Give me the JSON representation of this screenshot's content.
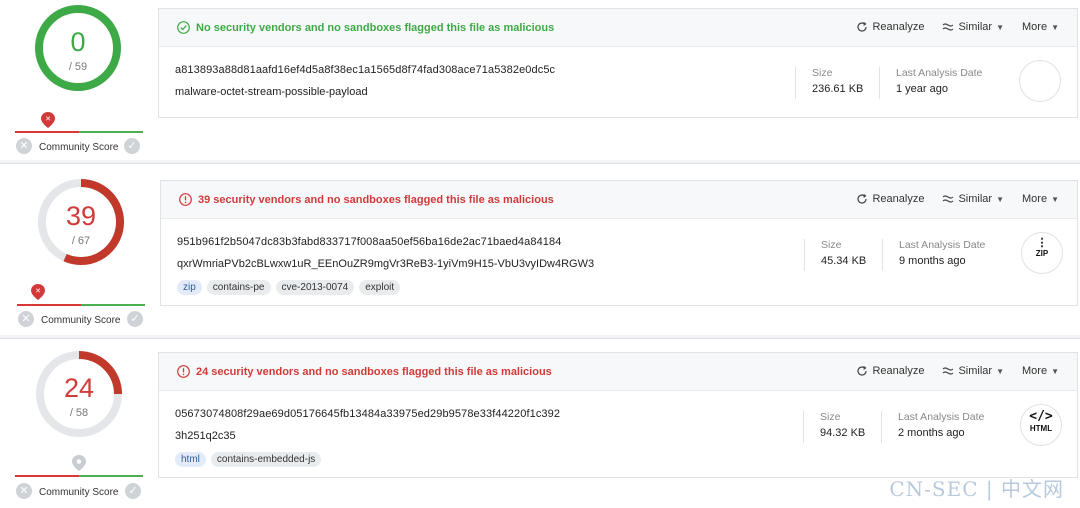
{
  "colors": {
    "clean": "#3eaa47",
    "malicious": "#d23a3a",
    "neutral": "#c9ccd0",
    "tag_blue": "#2f5e9e"
  },
  "actions": {
    "reanalyze": "Reanalyze",
    "similar": "Similar",
    "more": "More"
  },
  "meta_labels": {
    "size": "Size",
    "last_analysis": "Last Analysis Date"
  },
  "community_label": "Community Score",
  "results": [
    {
      "score": "0",
      "total": "/ 59",
      "detections": 0,
      "engines": 59,
      "verdict": "No security vendors and no sandboxes flagged this file as malicious",
      "verdict_status": "clean",
      "hash": "a813893a88d81aafd16ef4d5a8f38ec1a1565d8f74fad308ace71a5382e0dc5c",
      "filename": "malware-octet-stream-possible-payload",
      "tags": [],
      "size": "236.61 KB",
      "last_analysis": "1 year ago",
      "file_type": "",
      "file_type_icon": "blank-icon",
      "community_icon": "red-pin-icon"
    },
    {
      "score": "39",
      "total": "/ 67",
      "detections": 39,
      "engines": 67,
      "verdict": "39 security vendors and no sandboxes flagged this file as malicious",
      "verdict_status": "malicious",
      "hash": "951b961f2b5047dc83b3fabd833717f008aa50ef56ba16de2ac71baed4a84184",
      "filename": "qxrWmriaPVb2cBLwxw1uR_EEnOuZR9mgVr3ReB3-1yiVm9H15-VbU3vyIDw4RGW3",
      "tags": [
        "zip",
        "contains-pe",
        "cve-2013-0074",
        "exploit"
      ],
      "size": "45.34 KB",
      "last_analysis": "9 months ago",
      "file_type": "ZIP",
      "file_type_icon": "zip-file-icon",
      "community_icon": "red-pin-icon"
    },
    {
      "score": "24",
      "total": "/ 58",
      "detections": 24,
      "engines": 58,
      "verdict": "24 security vendors and no sandboxes flagged this file as malicious",
      "verdict_status": "malicious",
      "hash": "05673074808f29ae69d05176645fb13484a33975ed29b9578e33f44220f1c392",
      "filename": "3h251q2c35",
      "tags": [
        "html",
        "contains-embedded-js"
      ],
      "size": "94.32 KB",
      "last_analysis": "2 months ago",
      "file_type": "HTML",
      "file_type_icon": "html-file-icon",
      "community_icon": "grey-pin-icon"
    }
  ],
  "watermark": "CN-SEC | 中文网"
}
